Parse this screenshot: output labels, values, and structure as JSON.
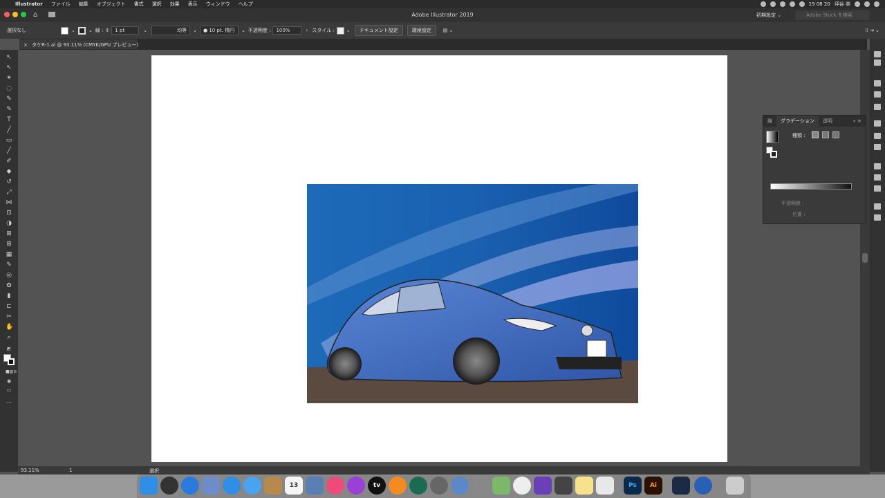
{
  "menubar": {
    "apple": "",
    "app": "Illustrator",
    "items": [
      "ファイル",
      "編集",
      "オブジェクト",
      "書式",
      "選択",
      "効果",
      "表示",
      "ウィンドウ",
      "ヘルプ"
    ],
    "clock": "19 08 20",
    "user": "坪谷 崇"
  },
  "titlebar": {
    "title": "Adobe Illustrator 2019",
    "workspace": "初期設定",
    "stock_placeholder": "Adobe Stock を検索"
  },
  "controlbar": {
    "selection": "選択なし",
    "stroke_label": "線 :",
    "stroke_weight": "1 pt",
    "profile": "均等",
    "brush": "10 pt. 楕円",
    "opacity_label": "不透明度 :",
    "opacity": "100%",
    "style_label": "スタイル :",
    "doc_settings": "ドキュメント設定",
    "prefs": "環境設定"
  },
  "doctab": {
    "title": "タケR-1.ai @ 93.11% (CMYK/GPU プレビュー)",
    "close": "×"
  },
  "gradient_panel": {
    "tabs": [
      "線",
      "グラデーション",
      "透明"
    ],
    "type_label": "種類 :",
    "opacity_label": "不透明度 :",
    "position_label": "位置 :"
  },
  "statusbar": {
    "zoom": "93.11%",
    "page": "1",
    "tool": "選択"
  },
  "dock": {
    "icons": [
      "finder-icon",
      "siri-icon",
      "launchpad-icon",
      "preview-icon",
      "safari-icon",
      "messages-icon",
      "notes-brown-icon",
      "calendar-icon",
      "photos-app-icon",
      "itunes-icon",
      "podcasts-icon",
      "appletv-icon",
      "books-icon",
      "clock-icon",
      "system-preferences-icon",
      "network-icon",
      "scripts-icon",
      "maps-icon",
      "photos-icon",
      "imovie-icon",
      "keychain-icon",
      "stickies-icon",
      "textedit-icon",
      "photoshop-icon",
      "illustrator-icon",
      "shield-app-icon",
      "quicktime-icon",
      "trash-icon"
    ],
    "calendar_day": "13",
    "ps_label": "Ps",
    "ai_label": "Ai",
    "tv_label": "tv"
  },
  "colors": {
    "sky_blue": "#1f66b8",
    "car_blue": "#4a76c9",
    "road": "#5a4a40"
  }
}
